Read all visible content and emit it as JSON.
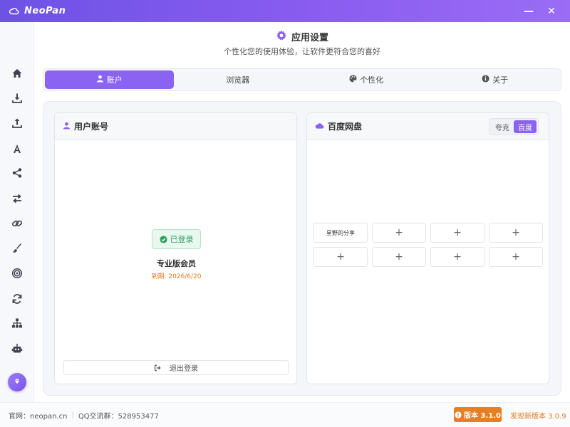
{
  "window": {
    "app_name": "NeoPan",
    "minimize_label": "—",
    "close_label": "✕"
  },
  "sidebar": {
    "items": [
      {
        "icon": "home-icon"
      },
      {
        "icon": "download-icon"
      },
      {
        "icon": "upload-icon"
      },
      {
        "icon": "font-icon"
      },
      {
        "icon": "share-icon"
      },
      {
        "icon": "transfer-icon"
      },
      {
        "icon": "link-icon"
      },
      {
        "icon": "brush-icon"
      },
      {
        "icon": "target-icon"
      },
      {
        "icon": "sync-icon"
      },
      {
        "icon": "sitemap-icon"
      },
      {
        "icon": "robot-icon"
      }
    ]
  },
  "header": {
    "title": "应用设置",
    "subtitle": "个性化您的使用体验，让软件更符合您的喜好"
  },
  "tabs": [
    {
      "label": "账户",
      "icon": "user-icon",
      "active": true
    },
    {
      "label": "浏览器",
      "icon": "",
      "active": false
    },
    {
      "label": "个性化",
      "icon": "palette-icon",
      "active": false
    },
    {
      "label": "关于",
      "icon": "info-icon",
      "active": false
    }
  ],
  "account_card": {
    "title": "用户账号",
    "status": "已登录",
    "member": "专业版会员",
    "expire": "到期: 2026/6/20",
    "logout": "退出登录"
  },
  "baidu_card": {
    "title": "百度网盘",
    "segments": [
      "夸克",
      "百度"
    ],
    "active_segment": "百度",
    "slots": [
      "星野的分享",
      "+",
      "+",
      "+",
      "+",
      "+",
      "+",
      "+"
    ]
  },
  "footer": {
    "site": "官网：neopan.cn",
    "qq": "QQ交流群：528953477",
    "version": "版本 3.1.0",
    "new_version": "发现新版本 3.0.9"
  },
  "colors": {
    "accent": "#8b63f2",
    "title_gradient_start": "#6d52e6",
    "success": "#2a9d5c",
    "warning": "#e67e22"
  }
}
